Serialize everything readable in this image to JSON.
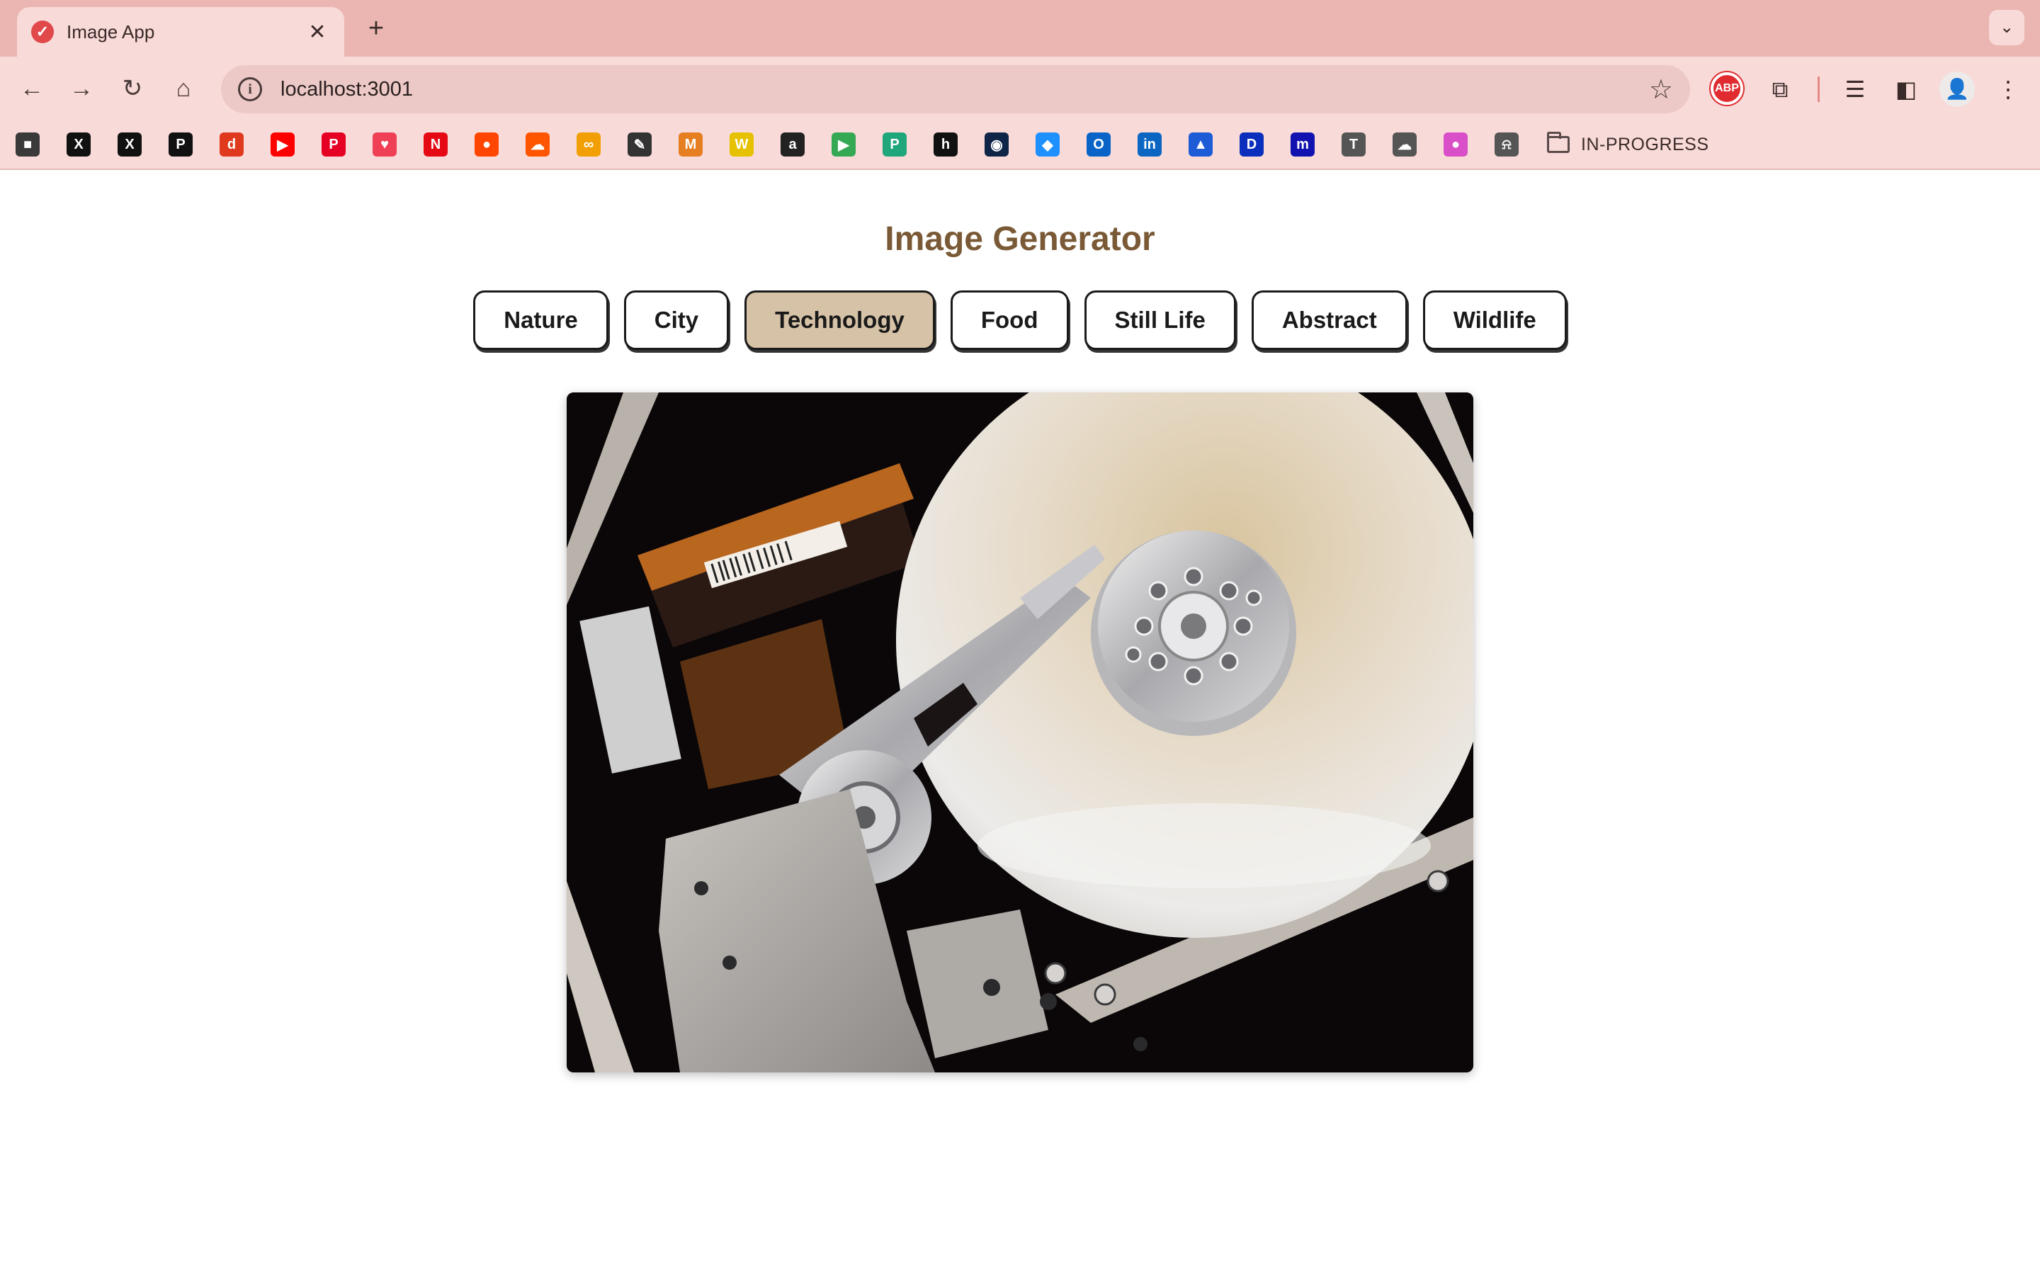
{
  "browser": {
    "tab_title": "Image App",
    "tab_close": "✕",
    "new_tab": "+",
    "url": "localhost:3001",
    "bookmark_folder": "IN-PROGRESS",
    "extension_abp": "ABP",
    "bookmarks": [
      {
        "name": "cube",
        "glyph": "■",
        "color": "#3a3a3a"
      },
      {
        "name": "x",
        "glyph": "X",
        "color": "#111111"
      },
      {
        "name": "x",
        "glyph": "X",
        "color": "#111111"
      },
      {
        "name": "p",
        "glyph": "P",
        "color": "#111111"
      },
      {
        "name": "d",
        "glyph": "d",
        "color": "#e03a1e"
      },
      {
        "name": "youtube",
        "glyph": "▶",
        "color": "#ff0000"
      },
      {
        "name": "pinterest",
        "glyph": "P",
        "color": "#e60023"
      },
      {
        "name": "pocket",
        "glyph": "♥",
        "color": "#ef4056"
      },
      {
        "name": "netflix",
        "glyph": "N",
        "color": "#e50914"
      },
      {
        "name": "reddit",
        "glyph": "●",
        "color": "#ff4500"
      },
      {
        "name": "soundcloud",
        "glyph": "☁",
        "color": "#ff5500"
      },
      {
        "name": "link",
        "glyph": "∞",
        "color": "#f29f05"
      },
      {
        "name": "edit",
        "glyph": "✎",
        "color": "#333333"
      },
      {
        "name": "m",
        "glyph": "M",
        "color": "#e67e22"
      },
      {
        "name": "w",
        "glyph": "W",
        "color": "#e5c100"
      },
      {
        "name": "amazon",
        "glyph": "a",
        "color": "#222222"
      },
      {
        "name": "play",
        "glyph": "▶",
        "color": "#34a853"
      },
      {
        "name": "p-green",
        "glyph": "P",
        "color": "#1fa67a"
      },
      {
        "name": "h",
        "glyph": "h",
        "color": "#111111"
      },
      {
        "name": "bot",
        "glyph": "◉",
        "color": "#0f2547"
      },
      {
        "name": "cube-blue",
        "glyph": "◆",
        "color": "#1e90ff"
      },
      {
        "name": "outlook",
        "glyph": "O",
        "color": "#0a64c8"
      },
      {
        "name": "linkedin",
        "glyph": "in",
        "color": "#0a66c2"
      },
      {
        "name": "arc",
        "glyph": "▲",
        "color": "#1e5bd6"
      },
      {
        "name": "disney",
        "glyph": "D",
        "color": "#0a2fbd"
      },
      {
        "name": "m-blue",
        "glyph": "m",
        "color": "#1212b0"
      },
      {
        "name": "tfb",
        "glyph": "T",
        "color": "#555555"
      },
      {
        "name": "cloud",
        "glyph": "☁",
        "color": "#555555"
      },
      {
        "name": "color",
        "glyph": "●",
        "color": "#d94fc8"
      },
      {
        "name": "bell",
        "glyph": "⍾",
        "color": "#555555"
      }
    ]
  },
  "app": {
    "title": "Image Generator",
    "categories": [
      "Nature",
      "City",
      "Technology",
      "Food",
      "Still Life",
      "Abstract",
      "Wildlife"
    ],
    "active_category": "Technology"
  }
}
